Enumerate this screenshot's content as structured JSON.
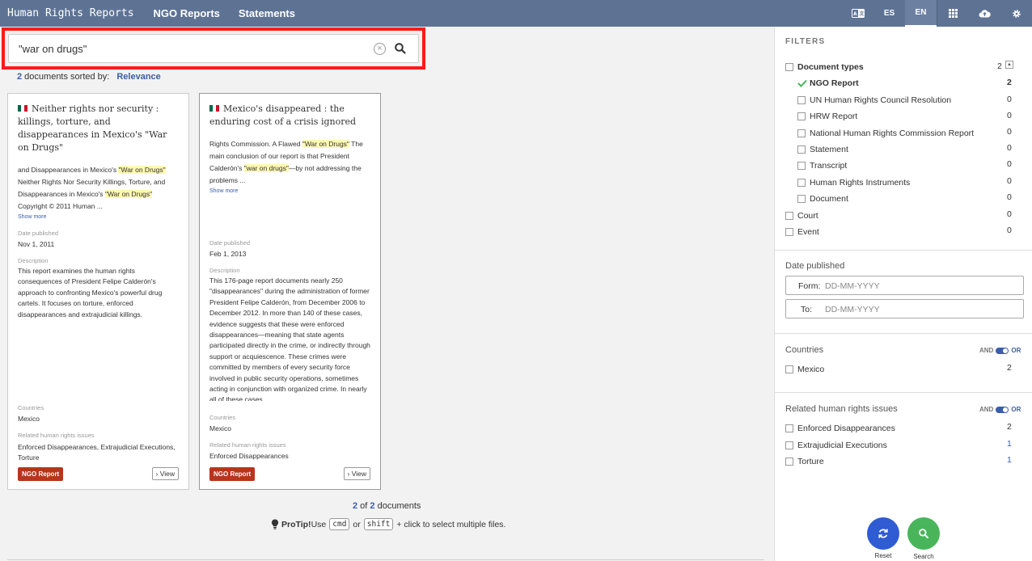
{
  "nav": {
    "brand": "Human Rights Reports",
    "links": [
      "NGO Reports",
      "Statements"
    ],
    "lang_es": "ES",
    "lang_en": "EN"
  },
  "search": {
    "value": "\"war on drugs\"",
    "clear_glyph": "×",
    "result_count": "2",
    "sorted_by_text": " documents sorted by:",
    "sort_value": "Relevance"
  },
  "cards": [
    {
      "title": "Neither rights nor security : killings, torture, and disappearances in Mexico's \"War on Drugs\"",
      "snippet": [
        {
          "t": "and Disappearances in Mexico's ",
          "h": false
        },
        {
          "t": "\"War on Drugs\"",
          "h": true
        },
        {
          "t": " Neither Rights Nor Security Killings, Torture, and Disappearances in Mexico's ",
          "h": false
        },
        {
          "t": "\"War on Drugs\"",
          "h": true
        },
        {
          "t": " Copyright © 2011 Human ...",
          "h": false
        }
      ],
      "show_more": "Show more",
      "date_label": "Date published",
      "date": "Nov 1, 2011",
      "desc_label": "Description",
      "description": "This report examines the human rights consequences of President Felipe Calderón's approach to confronting Mexico's powerful drug cartels. It focuses on torture, enforced disappearances and extrajudicial killings.",
      "countries_label": "Countries",
      "countries": "Mexico",
      "issues_label": "Related human rights issues",
      "issues": "Enforced Disappearances, Extrajudicial Executions, Torture",
      "badge": "NGO Report",
      "view": "View"
    },
    {
      "title": "Mexico's disappeared : the enduring cost of a crisis ignored",
      "snippet": [
        {
          "t": "Rights Commission. A Flawed ",
          "h": false
        },
        {
          "t": "\"War on Drugs\"",
          "h": true
        },
        {
          "t": " The main conclusion of our report is that President Calderón's ",
          "h": false
        },
        {
          "t": "\"war on drugs\"",
          "h": true
        },
        {
          "t": "—by not addressing the problems ...",
          "h": false
        }
      ],
      "show_more": "Show more",
      "date_label": "Date published",
      "date": "Feb 1, 2013",
      "desc_label": "Description",
      "description": "This 176-page report documents nearly 250 \"disappearances\" during the administration of former President Felipe Calderón, from December 2006 to December 2012. In more than 140 of these cases, evidence suggests that these were enforced disappearances—meaning that state agents participated directly in the crime, or indirectly through support or acquiescence. These crimes were committed by members of every security force involved in public security operations, sometimes acting in conjunction with organized crime. In nearly all of these cases,",
      "countries_label": "Countries",
      "countries": "Mexico",
      "issues_label": "Related human rights issues",
      "issues": "Enforced Disappearances",
      "badge": "NGO Report",
      "view": "View"
    }
  ],
  "footer": {
    "shown": "2",
    "of_text": " of ",
    "total": "2",
    "docs_text": " documents",
    "protip_label": "ProTip!",
    "protip_use": " Use",
    "key_cmd": "cmd",
    "or_text": "or",
    "key_shift": "shift",
    "protip_tail": "+ click to select multiple files."
  },
  "filters": {
    "title": "FILTERS",
    "doc_types": {
      "label": "Document types",
      "count": "2",
      "items": [
        {
          "label": "NGO Report",
          "count": "2",
          "checked": true
        },
        {
          "label": "UN Human Rights Council Resolution",
          "count": "0"
        },
        {
          "label": "HRW Report",
          "count": "0"
        },
        {
          "label": "National Human Rights Commission Report",
          "count": "0"
        },
        {
          "label": "Statement",
          "count": "0"
        },
        {
          "label": "Transcript",
          "count": "0"
        },
        {
          "label": "Human Rights Instruments",
          "count": "0"
        },
        {
          "label": "Document",
          "count": "0"
        }
      ]
    },
    "court": {
      "label": "Court",
      "count": "0"
    },
    "event": {
      "label": "Event",
      "count": "0"
    },
    "date": {
      "label": "Date published",
      "from_label": "Form:",
      "to_label": "To:",
      "placeholder": "DD-MM-YYYY"
    },
    "countries": {
      "label": "Countries",
      "and": "AND",
      "or": "OR",
      "items": [
        {
          "label": "Mexico",
          "count": "2"
        }
      ]
    },
    "issues": {
      "label": "Related human rights issues",
      "and": "AND",
      "or": "OR",
      "items": [
        {
          "label": "Enforced Disappearances",
          "count": "2"
        },
        {
          "label": "Extrajudicial Executions",
          "count": "1"
        },
        {
          "label": "Torture",
          "count": "1"
        }
      ]
    },
    "reset_label": "Reset",
    "search_label": "Search",
    "colors": {
      "reset": "#2f5bd3",
      "search": "#49b55b",
      "accent": "#3b5dab",
      "badge": "#b8341c",
      "highlight_box": "#ff1a1a"
    }
  }
}
